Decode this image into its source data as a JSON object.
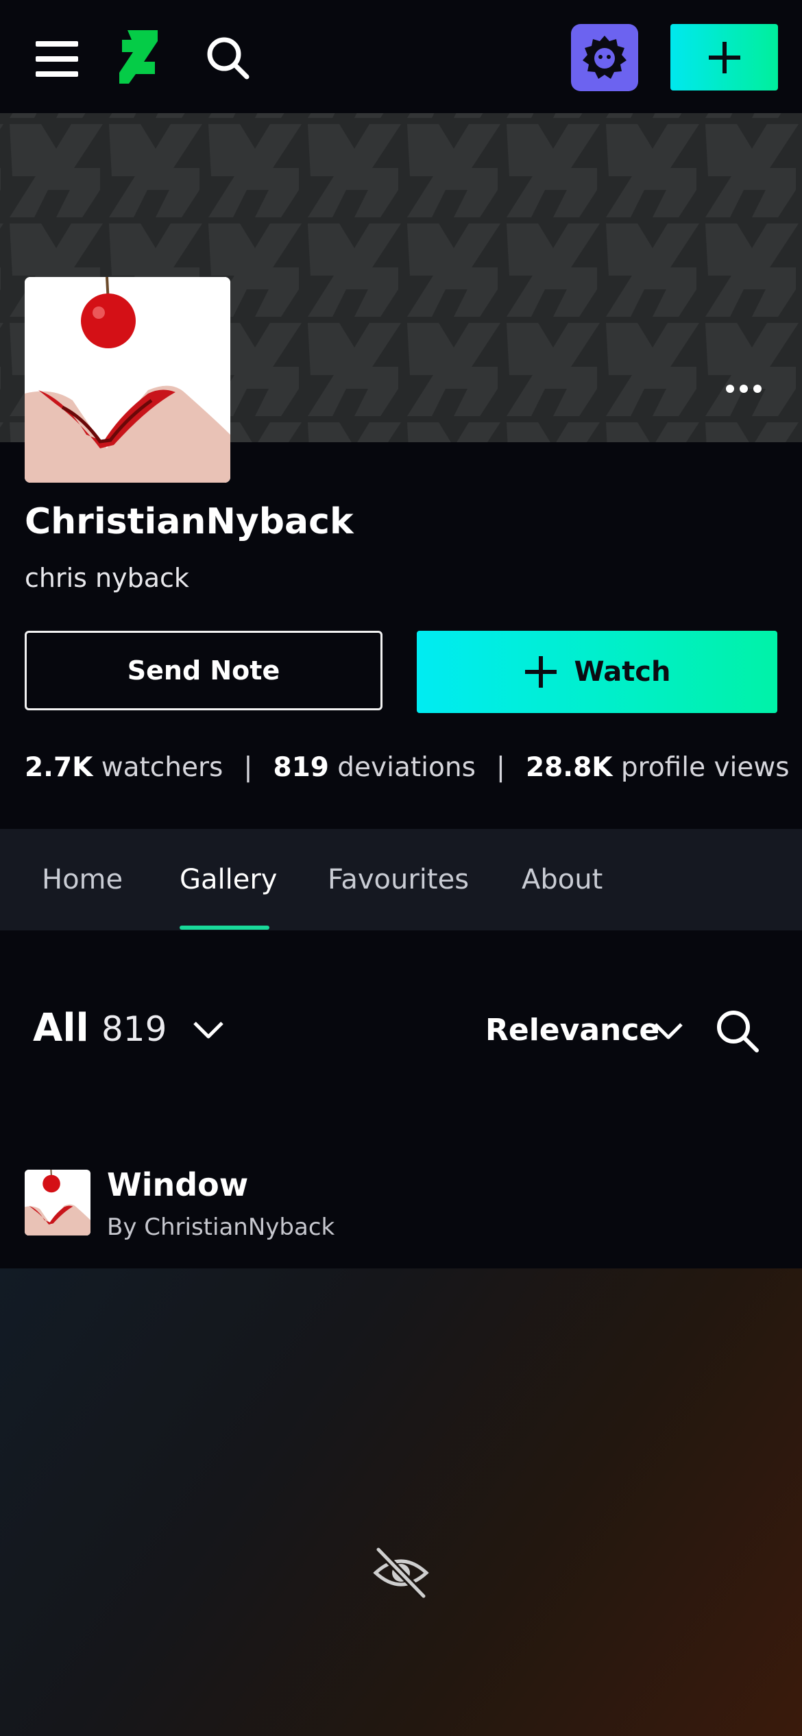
{
  "header": {
    "menu_icon": "hamburger-menu-icon",
    "logo_icon": "deviantart-logo-icon",
    "search_icon": "search-icon",
    "avatar_icon": "user-avatar-icon",
    "create_icon": "plus-icon",
    "accent": "#00ef9c",
    "avatar_bg": "#6c63f0"
  },
  "banner": {
    "more_icon": "more-dots-icon"
  },
  "profile": {
    "username": "ChristianNyback",
    "real_name": "chris nyback",
    "send_note_label": "Send Note",
    "watch_label": "Watch",
    "stats": {
      "watchers_value": "2.7K",
      "watchers_label": "watchers",
      "deviations_value": "819",
      "deviations_label": "deviations",
      "views_value": "28.8K",
      "views_label": "profile views",
      "separator": "|"
    }
  },
  "tabs": [
    {
      "label": "Home",
      "active": false
    },
    {
      "label": "Gallery",
      "active": true
    },
    {
      "label": "Favourites",
      "active": false
    },
    {
      "label": "About",
      "active": false
    }
  ],
  "gallery": {
    "filter_label": "All",
    "filter_count": "819",
    "sort_label": "Relevance",
    "search_icon": "search-icon"
  },
  "deviation": {
    "title": "Window",
    "author": "By ChristianNyback",
    "hidden_icon": "eye-slash-icon"
  }
}
